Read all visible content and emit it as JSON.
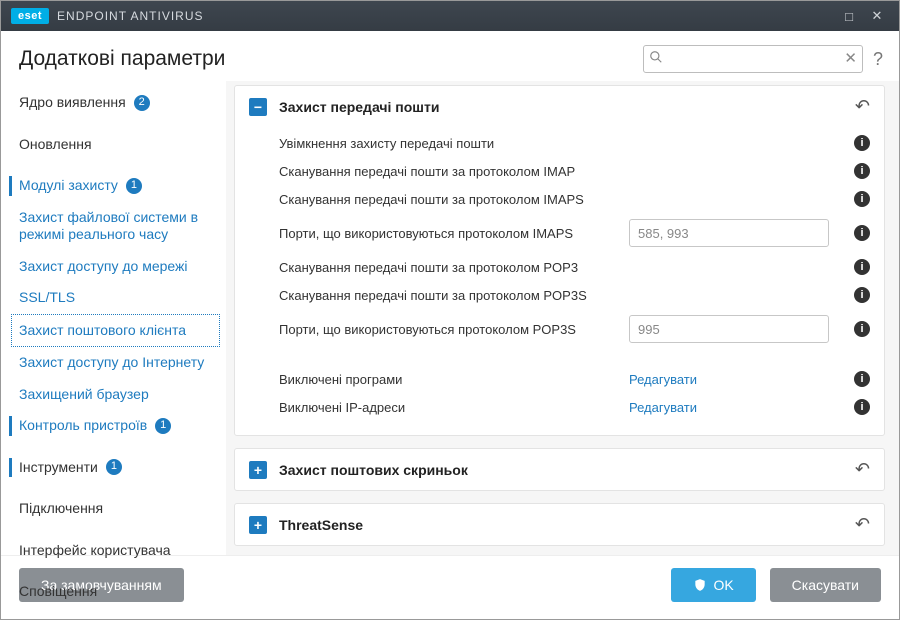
{
  "titlebar": {
    "brand_badge": "eset",
    "brand_text": "ENDPOINT ANTIVIRUS"
  },
  "header": {
    "title": "Додаткові параметри",
    "search_placeholder": ""
  },
  "sidebar": {
    "items": [
      {
        "label": "Ядро виявлення",
        "badge": "2",
        "kind": "top"
      },
      {
        "label": "Оновлення",
        "kind": "top"
      },
      {
        "label": "Модулі захисту",
        "badge": "1",
        "kind": "top-link"
      },
      {
        "label": "Захист файлової системи в режимі реального часу",
        "kind": "sub-link"
      },
      {
        "label": "Захист доступу до мережі",
        "kind": "sub-link"
      },
      {
        "label": "SSL/TLS",
        "kind": "sub-link"
      },
      {
        "label": "Захист поштового клієнта",
        "kind": "sub-link-selected"
      },
      {
        "label": "Захист доступу до Інтернету",
        "kind": "sub-link"
      },
      {
        "label": "Захищений браузер",
        "kind": "sub-link"
      },
      {
        "label": "Контроль пристроїв",
        "badge": "1",
        "kind": "sub-link"
      },
      {
        "label": "Інструменти",
        "badge": "1",
        "kind": "top-link"
      },
      {
        "label": "Підключення",
        "kind": "top"
      },
      {
        "label": "Інтерфейс користувача",
        "kind": "top"
      },
      {
        "label": "Сповіщення",
        "kind": "top"
      }
    ]
  },
  "panels": {
    "email_transport": {
      "title": "Захист передачі пошти",
      "expanded": true,
      "rows": [
        {
          "label": "Увімкнення захисту передачі пошти",
          "type": "toggle",
          "value": true
        },
        {
          "label": "Сканування передачі пошти за протоколом IMAP",
          "type": "toggle",
          "value": true
        },
        {
          "label": "Сканування передачі пошти за протоколом IMAPS",
          "type": "toggle",
          "value": true
        },
        {
          "label": "Порти, що використовуються протоколом IMAPS",
          "type": "text",
          "value": "585, 993"
        },
        {
          "label": "Сканування передачі пошти за протоколом POP3",
          "type": "toggle",
          "value": true
        },
        {
          "label": "Сканування передачі пошти за протоколом POP3S",
          "type": "toggle",
          "value": true
        },
        {
          "label": "Порти, що використовуються протоколом POP3S",
          "type": "text",
          "value": "995"
        }
      ],
      "extra": [
        {
          "label": "Виключені програми",
          "action": "Редагувати"
        },
        {
          "label": "Виключені IP-адреси",
          "action": "Редагувати"
        }
      ]
    },
    "mailboxes": {
      "title": "Захист поштових скриньок",
      "expanded": false
    },
    "threatsense": {
      "title": "ThreatSense",
      "expanded": false
    }
  },
  "footer": {
    "defaults": "За замовчуванням",
    "ok": "OK",
    "cancel": "Скасувати"
  }
}
